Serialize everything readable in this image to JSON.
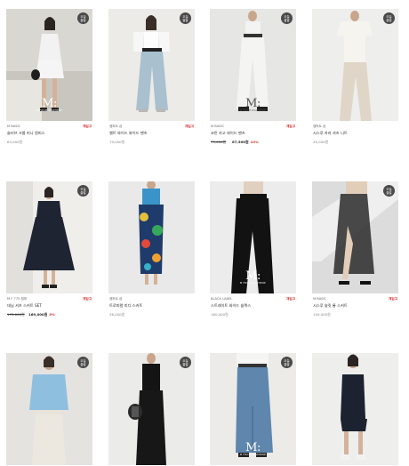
{
  "products": [
    {
      "brand": "M BASIC",
      "tag": "재입고",
      "name": "슬리브 크롭 미니 원피스",
      "price": "63,000원",
      "badge": [
        "오늘",
        "출발"
      ],
      "logo": true
    },
    {
      "brand": "캠퍼트 샵",
      "tag": "재입고",
      "name": "벨트 와이드 와이드 팬츠",
      "price": "79,000원",
      "badge": [
        "오늘",
        "출발"
      ],
      "logo": false
    },
    {
      "brand": "M BASIC",
      "tag": "재입고",
      "name": "코튼 카고 와이드 팬츠",
      "orig_price": "75,000원",
      "sale_price": "67,500원",
      "discount": "10%",
      "badge": [
        "오늘",
        "출발"
      ],
      "logo": true
    },
    {
      "brand": "캠퍼트 샵",
      "tag": "",
      "name": "시스루 카라 셔츠 니트",
      "price": "49,000원",
      "badge": [
        "오늘",
        "출발"
      ],
      "logo": false
    },
    {
      "brand": "M F 775 캠퍼",
      "tag": "재입고",
      "name": "데님 셔츠 스커트 SET",
      "orig_price": "178,000원",
      "sale_price": "169,000원",
      "discount": "5%",
      "badge": [
        "오늘",
        "출발"
      ],
      "logo": false
    },
    {
      "brand": "캠퍼트 샵",
      "tag": "",
      "name": "트로피컬 미디 스커트",
      "price": "56,000원",
      "badge": [],
      "logo": false
    },
    {
      "brand": "BLACK LABEL",
      "tag": "재입고",
      "name": "스트레이트 와이드 슬랙스",
      "price": "160,000원",
      "badge": [],
      "logo": true
    },
    {
      "brand": "M BASIC",
      "tag": "재입고",
      "name": "시스루 슬릿 롱 스커트",
      "price": "109,000원",
      "badge": [
        "오늘",
        "출발"
      ],
      "logo": false
    },
    {
      "brand": "",
      "tag": "",
      "name": "",
      "price": "",
      "badge": [
        "오늘",
        "출발"
      ],
      "logo": false
    },
    {
      "brand": "",
      "tag": "",
      "name": "",
      "price": "",
      "badge": [
        "오늘",
        "출발"
      ],
      "logo": false
    },
    {
      "brand": "",
      "tag": "",
      "name": "",
      "price": "",
      "badge": [
        "오늘",
        "출발"
      ],
      "logo": true
    },
    {
      "brand": "",
      "tag": "",
      "name": "",
      "price": "",
      "badge": [],
      "logo": false
    }
  ],
  "logo": {
    "mark": "M:",
    "sub": "M FROM NOWHERE"
  },
  "colors": {
    "accent": "#dd3333",
    "badge_bg": "#4a4a4a"
  }
}
